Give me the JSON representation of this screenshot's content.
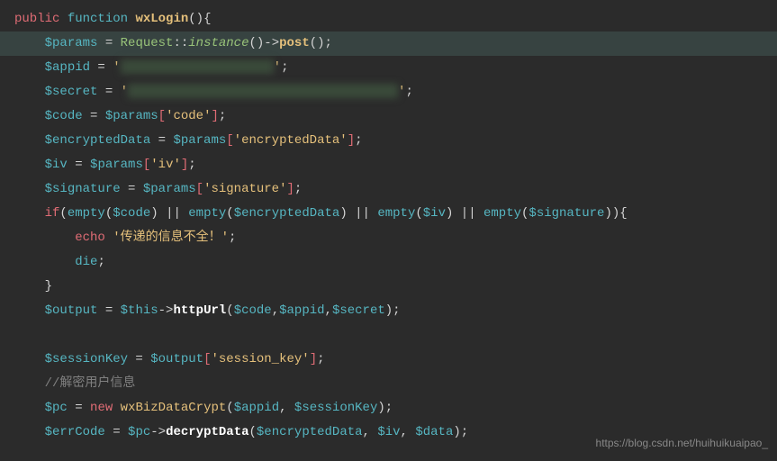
{
  "code": {
    "line1": {
      "access": "public",
      "func_kw": "function",
      "fn_name": "wxLogin",
      "parens": "()",
      "brace": "{"
    },
    "line2": {
      "var": "$params",
      "eq": " = ",
      "class": "Request",
      "dcolon": "::",
      "method": "instance",
      "p1": "()",
      "arrow": "->",
      "post": "post",
      "p2": "()",
      "semi": ";"
    },
    "line3": {
      "var": "$appid",
      "eq": " = ",
      "q1": "'",
      "q2": "'",
      "semi": ";"
    },
    "line4": {
      "var": "$secret",
      "eq": " = ",
      "q1": "'",
      "q2": "'",
      "semi": ";"
    },
    "line5": {
      "var": "$code",
      "eq": " = ",
      "var2": "$params",
      "br1": "[",
      "key": "'code'",
      "br2": "]",
      "semi": ";"
    },
    "line6": {
      "var": "$encryptedData",
      "eq": " = ",
      "var2": "$params",
      "br1": "[",
      "key": "'encryptedData'",
      "br2": "]",
      "semi": ";"
    },
    "line7": {
      "var": "$iv",
      "eq": " = ",
      "var2": "$params",
      "br1": "[",
      "key": "'iv'",
      "br2": "]",
      "semi": ";"
    },
    "line8": {
      "var": "$signature",
      "eq": " = ",
      "var2": "$params",
      "br1": "[",
      "key": "'signature'",
      "br2": "]",
      "semi": ";"
    },
    "line9": {
      "if": "if",
      "p1": "(",
      "empty": "empty",
      "p2": "(",
      "v1": "$code",
      "p3": ")",
      "or1": " || ",
      "p4": "(",
      "v2": "$encryptedData",
      "p5": ")",
      "or2": " || ",
      "p6": "(",
      "v3": "$iv",
      "p7": ")",
      "or3": " || ",
      "p8": "(",
      "v4": "$signature",
      "p9": "))",
      "brace": "{"
    },
    "line10": {
      "echo": "echo",
      "str": "'传递的信息不全！'",
      "semi": ";"
    },
    "line11": {
      "die": "die",
      "semi": ";"
    },
    "line12": {
      "brace": "}"
    },
    "line13": {
      "var": "$output",
      "eq": " = ",
      "this": "$this",
      "arrow": "->",
      "method": "httpUrl",
      "p1": "(",
      "a1": "$code",
      "c1": ",",
      "a2": "$appid",
      "c2": ",",
      "a3": "$secret",
      "p2": ")",
      "semi": ";"
    },
    "line15": {
      "var": "$sessionKey",
      "eq": " = ",
      "var2": "$output",
      "br1": "[",
      "key": "'session_key'",
      "br2": "]",
      "semi": ";"
    },
    "line16": {
      "comment": "//解密用户信息"
    },
    "line17": {
      "var": "$pc",
      "eq": " = ",
      "new": "new",
      "class": "wxBizDataCrypt",
      "p1": "(",
      "a1": "$appid",
      "c1": ",",
      "a2": " $sessionKey",
      "p2": ")",
      "semi": ";"
    },
    "line18": {
      "var": "$errCode",
      "eq": " = ",
      "var2": "$pc",
      "arrow": "->",
      "method": "decryptData",
      "p1": "(",
      "a1": "$encryptedData",
      "c1": ",",
      "a2": " $iv",
      "c2": ",",
      "a3": " $data",
      "p2": ")",
      "semi": ";"
    }
  },
  "watermark": "https://blog.csdn.net/huihuikuaipao_"
}
